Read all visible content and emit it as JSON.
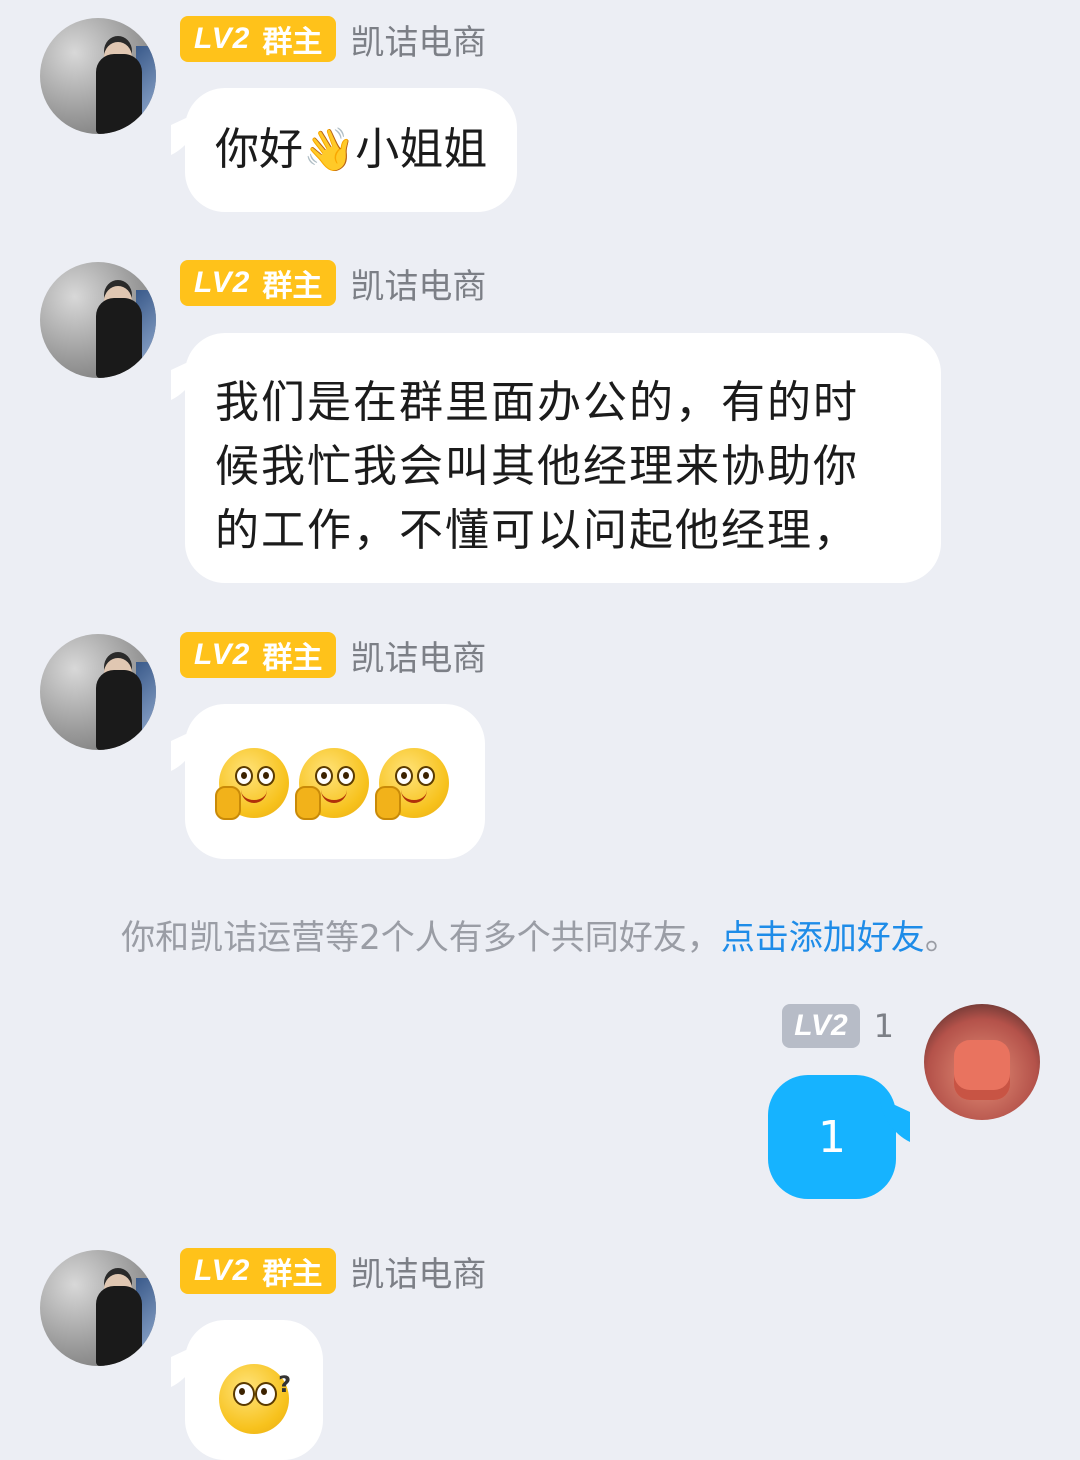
{
  "messages": [
    {
      "badge_level": "LV2",
      "badge_role": "群主",
      "sender": "凯诘电商",
      "text_before": "你好",
      "emoji": "waving-hand",
      "text_after": "小姐姐"
    },
    {
      "badge_level": "LV2",
      "badge_role": "群主",
      "sender": "凯诘电商",
      "lines": [
        "我们是在群里面办公的，有的时",
        "候我忙我会叫其他经理来协助你",
        "的工作，不懂可以问起他经理，"
      ]
    },
    {
      "badge_level": "LV2",
      "badge_role": "群主",
      "sender": "凯诘电商",
      "emojis": [
        "thinking-face",
        "thinking-face",
        "thinking-face"
      ]
    },
    {
      "badge_level": "LV2",
      "badge_role": "群主",
      "sender": "凯诘电商",
      "emojis": [
        "confused-face"
      ]
    }
  ],
  "notice": {
    "text": "你和凯诘运营等2个人有多个共同好友，",
    "link": "点击添加好友",
    "end": "。"
  },
  "self_message": {
    "badge_level": "LV2",
    "sender": "1",
    "text": "1"
  },
  "colors": {
    "background": "#eceef4",
    "owner_badge": "#ffc21a",
    "self_badge": "#b7bcc7",
    "self_bubble": "#16b3ff",
    "link": "#1e8ce8"
  }
}
